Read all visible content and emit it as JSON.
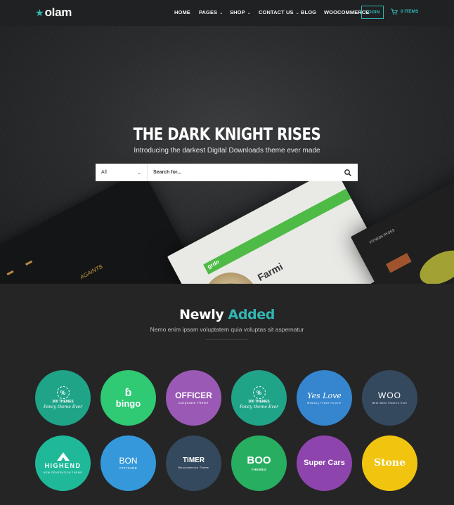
{
  "brand": {
    "name": "olam",
    "accent": "#33b5b3"
  },
  "nav": {
    "items": [
      {
        "label": "HOME",
        "has_dropdown": false
      },
      {
        "label": "PAGES",
        "has_dropdown": true
      },
      {
        "label": "SHOP",
        "has_dropdown": true
      },
      {
        "label": "CONTACT US",
        "has_dropdown": true
      },
      {
        "label": "BLOG",
        "has_dropdown": false
      },
      {
        "label": "WOOCOMMERCE",
        "has_dropdown": false
      }
    ],
    "login_label": "LOGIN",
    "cart_label": "0 ITEMS",
    "cart_icon": "cart-icon"
  },
  "hero": {
    "title": "THE DARK KNIGHT RISES",
    "subtitle": "Introducing the darkest Digital Downloads theme ever made",
    "search": {
      "category_value": "All",
      "placeholder": "Search for...",
      "button_icon": "search-icon"
    },
    "mockups": {
      "left_text": "AGAINTS",
      "center_brand": "grdn",
      "center_heading": "Farmi",
      "right_text": "FITNESS RYDES"
    }
  },
  "newly_added": {
    "title_part1": "Newly",
    "title_part2": "Added",
    "subtitle": "Nemo enim ipsam voluptatem quia voluptas sit aspernatur"
  },
  "themes": [
    {
      "badge": "%",
      "main": "300 THEMES",
      "sub": "Fancy theme Ever",
      "color": "#1fa488"
    },
    {
      "main": "bingo",
      "sub": "",
      "color": "#2fca73"
    },
    {
      "main": "OFFICER",
      "sub": "Corporate Theme",
      "color": "#9b59b6"
    },
    {
      "badge": "%",
      "main": "300 THEMES",
      "sub": "Fancy theme Ever",
      "color": "#1fa488"
    },
    {
      "main": "Yes Love",
      "sub": "Wedding Theme Forever",
      "color": "#3585cf"
    },
    {
      "main": "WOO",
      "sub": "Best WOO Theme's Ever",
      "color": "#34495e"
    },
    {
      "main": "HIGHEND",
      "sub": "NEW GENERATION THEME",
      "color": "#1fb99a"
    },
    {
      "main": "BON",
      "sub": "ATTITUDE",
      "color": "#3498db"
    },
    {
      "main": "TIMER",
      "sub": "Woocommerce Theme",
      "color": "#34495e"
    },
    {
      "main": "BOO",
      "sub": "THEMES",
      "color": "#27ae60"
    },
    {
      "main": "Super Cars",
      "sub": "",
      "color": "#8e44ad"
    },
    {
      "main": "Stone",
      "sub": "",
      "color": "#f1c40f"
    }
  ]
}
